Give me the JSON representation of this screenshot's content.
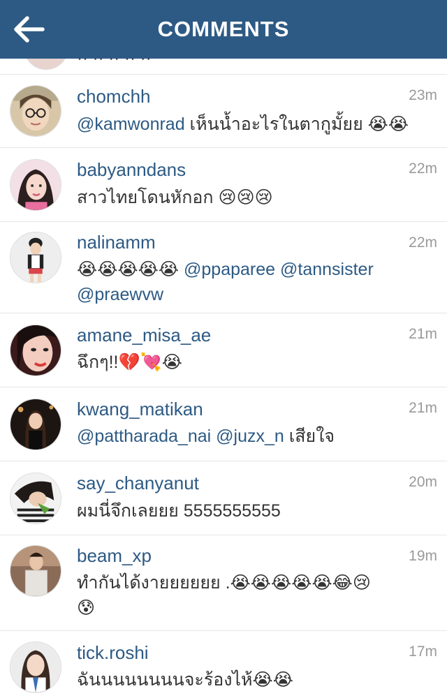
{
  "header": {
    "title": "COMMENTS"
  },
  "partial_row": {
    "text": "·· ·· ·· ·· ··"
  },
  "comments": [
    {
      "username": "chomchh",
      "time": "23m",
      "mention1": "@kamwonrad",
      "text": " เห็นน้ำอะไรในตากูมั้ยย ",
      "emoji": "😭😭"
    },
    {
      "username": "babyanndans",
      "time": "22m",
      "text": "สาวไทยโดนหักอก ",
      "emoji": "😢😢😢"
    },
    {
      "username": "nalinamm",
      "time": "22m",
      "emoji": "😭😭😭😭😭",
      "mention1": "@ppaparee",
      "mention2": "@tannsister",
      "mention3": "@praewvw"
    },
    {
      "username": "amane_misa_ae",
      "time": "21m",
      "text": "ฉึกๆ!!",
      "emoji": "💔💘😭"
    },
    {
      "username": "kwang_matikan",
      "time": "21m",
      "mention1": "@pattharada_nai",
      "mention2": "@juzx_n",
      "text": " เสียใจ"
    },
    {
      "username": "say_chanyanut",
      "time": "20m",
      "text": "ผมนี่จึกเลยยย  5555555555"
    },
    {
      "username": "beam_xp",
      "time": "19m",
      "text": "ทำกันได้งายยยยยย .",
      "emoji": "😭😭😭😭😭😂😢",
      "emoji2": "😰"
    },
    {
      "username": "tick.roshi",
      "time": "17m",
      "text": "ฉันนนนนนนนจะร้องไห้",
      "emoji": "😭😭"
    }
  ]
}
